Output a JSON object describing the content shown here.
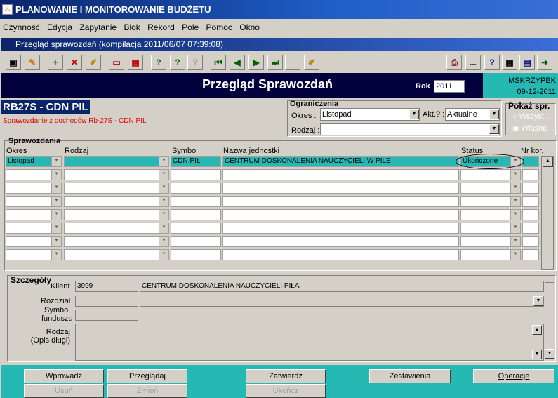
{
  "app": {
    "title": "PLANOWANIE I MONITOROWANIE BUDŻETU",
    "icon": "java-cup-icon"
  },
  "menu": [
    "Czynność",
    "Edycja",
    "Zapytanie",
    "Blok",
    "Rekord",
    "Pole",
    "Pomoc",
    "Okno"
  ],
  "window": {
    "title": "Przegląd sprawozdań (kompilacja 2011/06/07 07:39:08)"
  },
  "toolbar": {
    "icons": [
      "save-icon",
      "edit-icon",
      "add-icon",
      "delete-icon",
      "clear-icon",
      "insert-record-icon",
      "layout-icon",
      "query-icon",
      "query2-icon",
      "query-disabled-icon",
      "first-record-icon",
      "prev-record-icon",
      "next-record-icon",
      "last-record-icon",
      "blank-icon",
      "note-icon",
      "print-icon",
      "more-icon",
      "help-icon",
      "calculator-icon",
      "calendar-icon",
      "exit-icon"
    ],
    "ellipsis": "...",
    "help": "?"
  },
  "header": {
    "title": "Przegląd Sprawozdań",
    "rok_label": "Rok",
    "rok_value": "2011",
    "user": "MSKRZYPEK",
    "date": "09-12-2011"
  },
  "report": {
    "code": "RB27S - CDN PIL",
    "subtitle": "Sprawozdanie z dochodów Rb-27S - CDN PIL"
  },
  "ograniczenia": {
    "title": "Ograniczenia",
    "okres_label": "Okres :",
    "okres_value": "Listopad",
    "akt_label": "Akt.? :",
    "akt_value": "Aktualne",
    "rodzaj_label": "Rodzaj :",
    "rodzaj_value": ""
  },
  "pokaz": {
    "title": "Pokaż spr.",
    "opt1": "Wszyst...",
    "opt2": "Własne"
  },
  "sprawozdania": {
    "title": "Sprawozdania",
    "cols": [
      "Okres",
      "Rodzaj",
      "Symbol",
      "Nazwa jednostki",
      "Status",
      "Nr kor."
    ],
    "rows": [
      {
        "okres": "Listopad",
        "rodzaj": "",
        "symbol": "CDN PIŁ",
        "nazwa": "CENTRUM DOSKONALENIA NAUCZYCIELI W PILE",
        "status": "Ukończone",
        "nrkor": ""
      }
    ]
  },
  "szczegoly": {
    "title": "Szczegóły",
    "klient_label": "Klient",
    "klient_code": "3999",
    "klient_name": "CENTRUM DOSKONALENIA NAUCZYCIELI PIŁA",
    "rozdzial_label": "Rozdział",
    "symbol_label_1": "Symbol",
    "symbol_label_2": "funduszu",
    "rodzaj_label_1": "Rodzaj",
    "rodzaj_label_2": "(Opis długi)"
  },
  "buttons": {
    "wprowadz": "Wprowadź",
    "przegladaj": "Przeglądaj",
    "zatwierdz": "Zatwierdź",
    "zestawienia": "Zestawienia",
    "operacje": "Operacje",
    "usun": "Usuń",
    "zmien": "Zmień",
    "ukoncz": "Ukończ"
  },
  "colors": {
    "teal": "#26b8b3",
    "navy": "#00003c",
    "title_blue": "#0a246a"
  }
}
